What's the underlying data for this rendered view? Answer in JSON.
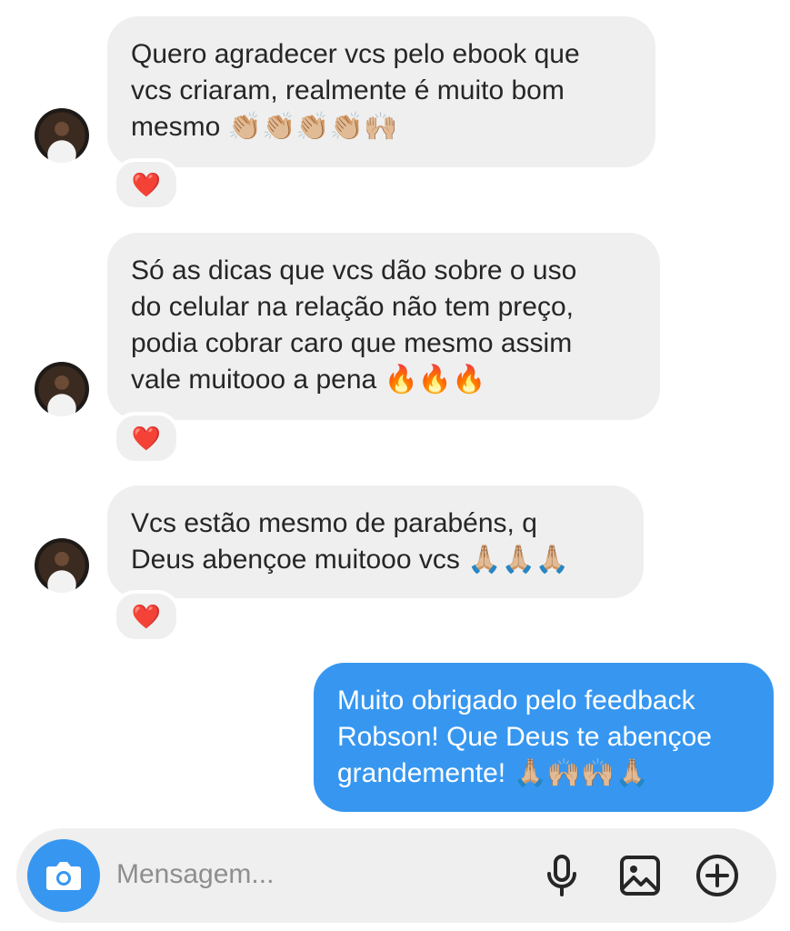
{
  "messages": [
    {
      "direction": "incoming",
      "text": "Quero agradecer vcs pelo ebook que\nvcs criaram, realmente é muito bom\nmesmo 👏🏼👏🏼👏🏼👏🏼🙌🏼",
      "reaction": "❤️"
    },
    {
      "direction": "incoming",
      "text": "Só as dicas que vcs dão sobre o uso\ndo celular na relação não tem preço,\npodia cobrar caro que mesmo assim\nvale muitooo a pena 🔥🔥🔥",
      "reaction": "❤️"
    },
    {
      "direction": "incoming",
      "text": "Vcs estão mesmo de parabéns, q\nDeus abençoe muitooo vcs 🙏🏼🙏🏼🙏🏼",
      "reaction": "❤️"
    },
    {
      "direction": "outgoing",
      "text": "Muito obrigado pelo feedback\nRobson! Que Deus te abençoe\ngrandemente! 🙏🏼🙌🏼🙌🏼🙏🏼"
    }
  ],
  "composer": {
    "placeholder": "Mensagem...",
    "icons": [
      "camera-icon",
      "microphone-icon",
      "gallery-icon",
      "add-circle-icon"
    ]
  },
  "colors": {
    "incoming_bubble": "#efefef",
    "outgoing_bubble": "#3797f0",
    "accent": "#3797f0"
  }
}
